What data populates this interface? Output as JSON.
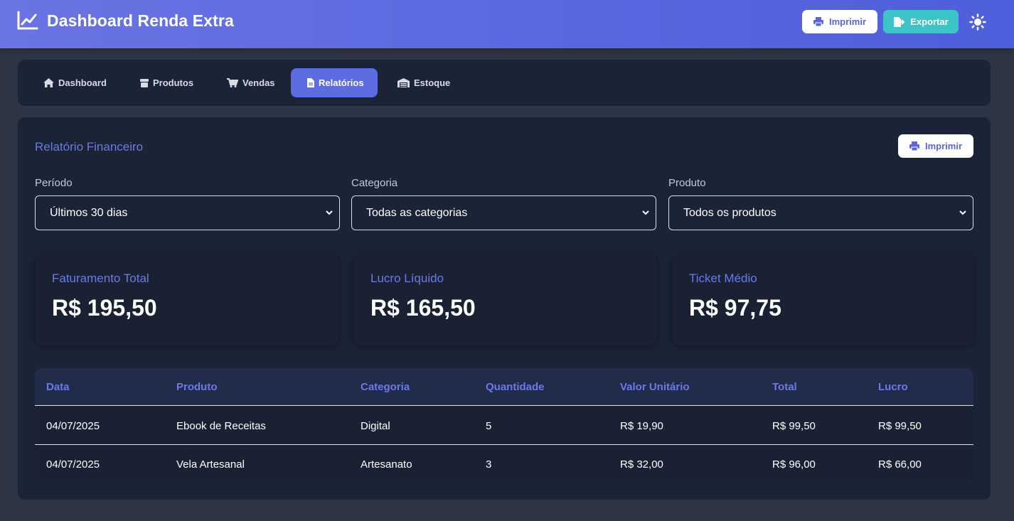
{
  "header": {
    "title": "Dashboard Renda Extra",
    "print_label": "Imprimir",
    "export_label": "Exportar"
  },
  "nav": {
    "tabs": [
      {
        "label": "Dashboard",
        "icon": "home-icon"
      },
      {
        "label": "Produtos",
        "icon": "box-icon"
      },
      {
        "label": "Vendas",
        "icon": "cart-icon"
      },
      {
        "label": "Relatórios",
        "icon": "file-icon",
        "active": true
      },
      {
        "label": "Estoque",
        "icon": "warehouse-icon"
      }
    ]
  },
  "report": {
    "title": "Relatório Financeiro",
    "print_label": "Imprimir",
    "filters": [
      {
        "label": "Período",
        "value": "Últimos 30 dias"
      },
      {
        "label": "Categoria",
        "value": "Todas as categorias"
      },
      {
        "label": "Produto",
        "value": "Todos os produtos"
      }
    ],
    "cards": [
      {
        "label": "Faturamento Total",
        "value": "R$ 195,50"
      },
      {
        "label": "Lucro Líquido",
        "value": "R$ 165,50"
      },
      {
        "label": "Ticket Médio",
        "value": "R$ 97,75"
      }
    ],
    "table": {
      "columns": [
        "Data",
        "Produto",
        "Categoria",
        "Quantidade",
        "Valor Unitário",
        "Total",
        "Lucro"
      ],
      "rows": [
        [
          "04/07/2025",
          "Ebook de Receitas",
          "Digital",
          "5",
          "R$ 19,90",
          "R$ 99,50",
          "R$ 99,50"
        ],
        [
          "04/07/2025",
          "Vela Artesanal",
          "Artesanato",
          "3",
          "R$ 32,00",
          "R$ 96,00",
          "R$ 66,00"
        ]
      ]
    }
  },
  "colors": {
    "accent": "#5d6ce0",
    "accent_text": "#6a7ae8",
    "export": "#3cc4c9",
    "panel": "#1b2336",
    "background": "#2d3443"
  }
}
